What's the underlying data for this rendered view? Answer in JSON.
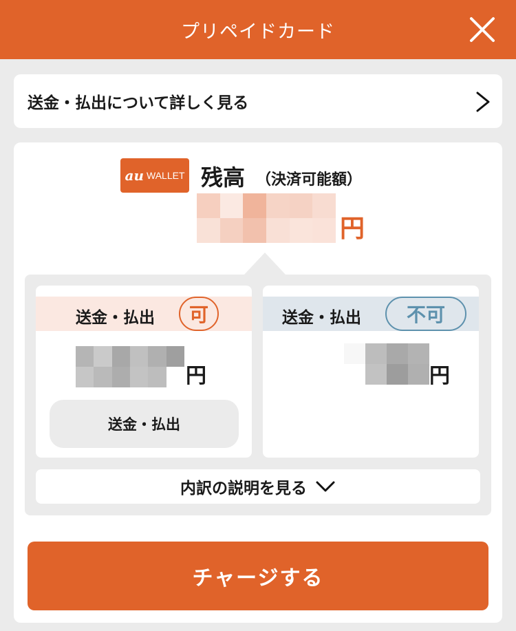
{
  "header": {
    "title": "プリペイドカード",
    "close_icon": "close-icon"
  },
  "link_card": {
    "label": "送金・払出について詳しく見る",
    "icon": "chevron-right-icon"
  },
  "balance": {
    "logo": {
      "mark": "au",
      "text": "WALLET"
    },
    "title": "残高",
    "subtitle": "（決済可能額）",
    "amount_redacted": true,
    "currency": "円",
    "accent_color": "#e0632a"
  },
  "breakdown": {
    "transferable": {
      "label": "送金・払出",
      "badge": "可",
      "currency": "円",
      "button_label": "送金・払出",
      "badge_color": "#e0632a"
    },
    "non_transferable": {
      "label": "送金・払出",
      "badge": "不可",
      "currency": "円",
      "badge_color": "#5d91ad"
    },
    "expand_label": "内訳の説明を見る",
    "expand_icon": "chevron-down-icon"
  },
  "charge_button": {
    "label": "チャージする"
  }
}
